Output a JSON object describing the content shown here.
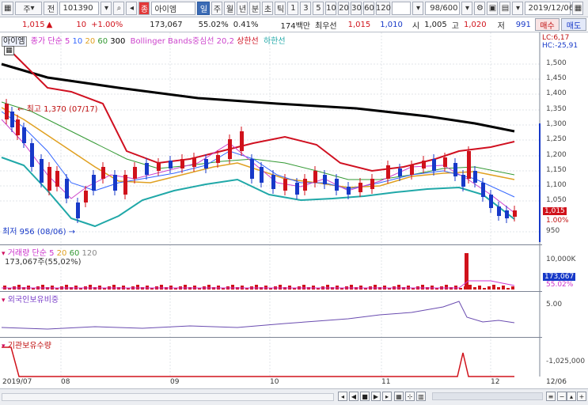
{
  "toolbar": {
    "icon_label": "▦",
    "dropdown1": "주",
    "dropdown2": "전",
    "code": "101390",
    "name_badge": "종",
    "name": "아이엠",
    "tabs": [
      "일",
      "주",
      "월",
      "년",
      "분",
      "초",
      "틱"
    ],
    "periods": [
      "1",
      "3",
      "5",
      "10",
      "20",
      "30",
      "60",
      "120"
    ],
    "counter": "98/600",
    "date": "2019/12/06"
  },
  "quote": {
    "price": "1,015",
    "change": "10",
    "rate": "+1.00%",
    "volume": "173,067",
    "vol_rate": "55.02%",
    "turnover": "0.41%",
    "amount": "174백만",
    "best_ask_label": "최우선",
    "best_ask": "1,015",
    "best_bid": "1,010",
    "open_label": "시",
    "open": "1,005",
    "high_label": "고",
    "high": "1,020",
    "low_label": "저",
    "low": "991",
    "buy": "매수",
    "sell": "매도"
  },
  "price_panel": {
    "title": "아이엠",
    "legend_ma": "종가 단순",
    "ma_periods": [
      "5",
      "10",
      "20",
      "60",
      "300"
    ],
    "legend_bb": "Bollinger Bands중심선 20,2",
    "legend_upper": "상한선",
    "legend_lower": "하한선",
    "high_note": "최고 1,370 (07/17)",
    "low_note": "최저 956 (08/06)",
    "lc": "LC:6,17",
    "hc": "HC:-25,91",
    "yaxis": [
      "1,500",
      "1,450",
      "1,400",
      "1,350",
      "1,300",
      "1,250",
      "1,200",
      "1,150",
      "1,100",
      "1,050",
      "1,015",
      "1.00%",
      "950"
    ]
  },
  "volume_panel": {
    "title": "거래량",
    "legend": "단순",
    "ma_periods": [
      "5",
      "20",
      "60",
      "120"
    ],
    "value": "173,067주(55,02%)",
    "yaxis": [
      "10,000K",
      "173,067",
      "55.02%"
    ]
  },
  "foreign_panel": {
    "title": "외국인보유비중",
    "yaxis": [
      "5.00"
    ]
  },
  "inst_panel": {
    "title": "기관보유수량",
    "yaxis": [
      "-1,025,000"
    ]
  },
  "xaxis": [
    "2019/07",
    "08",
    "09",
    "10",
    "11",
    "12",
    "12/06"
  ],
  "colors": {
    "up": "#d0121b",
    "down": "#1739c8",
    "ma5": "#cc33cc",
    "ma10": "#3366ff",
    "ma20": "#e0a020",
    "ma60": "#339933",
    "ma300": "#000000",
    "bb_mid": "#cc44cc",
    "bb_upper": "#d01020",
    "bb_lower": "#20a8a8"
  }
}
